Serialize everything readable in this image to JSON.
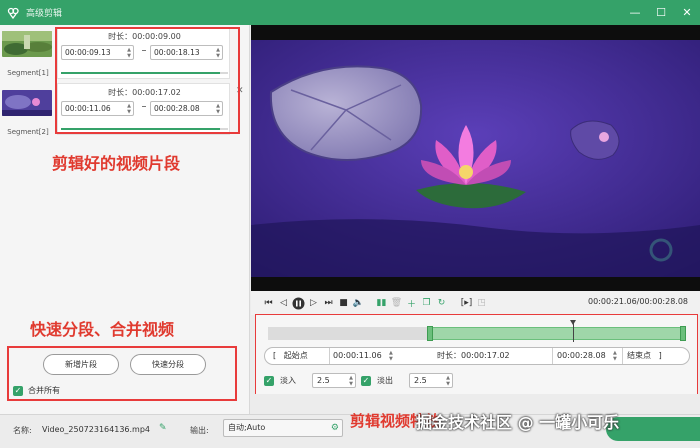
{
  "titlebar": {
    "title": "高级剪辑"
  },
  "segments": [
    {
      "label": "Segment[1]",
      "duration_text": "时长：00:00:09.00",
      "start": "00:00:09.13",
      "end": "00:00:18.13",
      "progress": 0.95
    },
    {
      "label": "Segment[2]",
      "duration_text": "时长：00:00:17.02",
      "start": "00:00:11.06",
      "end": "00:00:28.08",
      "progress": 0.95
    }
  ],
  "annotations": {
    "clips": "剪辑好的视频片段",
    "split_merge": "快速分段、合并视频",
    "effects": "剪辑视频特效"
  },
  "left_actions": {
    "add_segment": "新增片段",
    "quick_split": "快速分段",
    "merge_all": "合并所有"
  },
  "player": {
    "time": "00:00:21.06/00:00:28.08"
  },
  "timeline": {
    "selection_start": 0.38,
    "selection_end": 1.0,
    "playhead": 0.73,
    "start_label": "起始点",
    "start_time": "00:00:11.06",
    "duration_text": "时长：00:00:17.02",
    "end_time": "00:00:28.08",
    "end_label": "结束点",
    "fade_in_label": "淡入",
    "fade_in_value": "2.5",
    "fade_out_label": "淡出",
    "fade_out_value": "2.5"
  },
  "bottom": {
    "name_label": "名称:",
    "filename": "Video_250723164136.mp4",
    "output_label": "输出:",
    "output_value": "自动;Auto"
  },
  "watermark": "掘金技术社区 @ 一罐小可乐"
}
